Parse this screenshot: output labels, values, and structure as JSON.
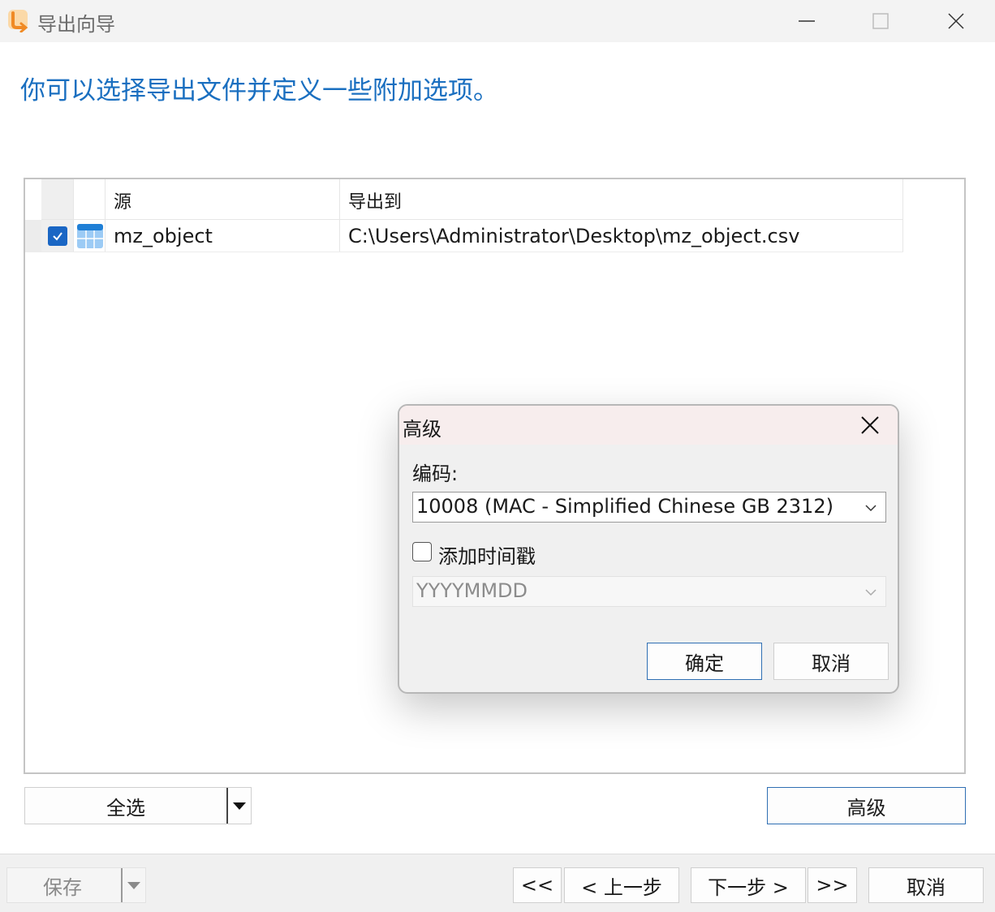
{
  "window": {
    "title": "导出向导",
    "brand_color": "#f08a24"
  },
  "heading": "你可以选择导出文件并定义一些附加选项。",
  "table": {
    "columns": [
      "源",
      "导出到"
    ],
    "rows": [
      {
        "checked": true,
        "icon": "table-icon",
        "source": "mz_object",
        "target": "C:\\Users\\Administrator\\Desktop\\mz_object.csv"
      }
    ]
  },
  "buttons": {
    "select_all": "全选",
    "advanced": "高级"
  },
  "footer": {
    "save": "保存",
    "first": "<<",
    "prev": "< 上一步",
    "next": "下一步 >",
    "last": ">>",
    "cancel": "取消"
  },
  "dialog": {
    "title": "高级",
    "encoding_label": "编码:",
    "encoding_value": "10008 (MAC - Simplified Chinese GB 2312)",
    "timestamp_label": "添加时间戳",
    "timestamp_checked": false,
    "timestamp_format": "YYYYMMDD",
    "ok": "确定",
    "cancel": "取消"
  },
  "colors": {
    "accent": "#1a6fc0",
    "checkbox": "#1a66c4",
    "dialog_title_bg": "#f7eded"
  }
}
